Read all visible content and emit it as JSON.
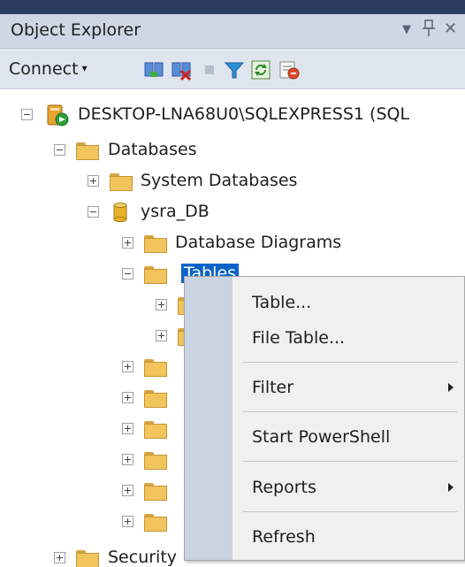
{
  "window": {
    "title": "Object Explorer",
    "pin_glyph": "↓",
    "pushpin_glyph": "ц",
    "close_glyph": "✕"
  },
  "toolbar": {
    "connect_label": "Connect",
    "connect_caret": "▾",
    "icons": [
      "connect-object-explorer-icon",
      "disconnect-icon",
      "stop-icon",
      "filter-icon",
      "refresh-icon",
      "activity-monitor-icon"
    ]
  },
  "tree": {
    "server": "DESKTOP-LNA68U0\\SQLEXPRESS1 (SQL",
    "databases": "Databases",
    "system_databases": "System Databases",
    "database": "ysra_DB",
    "database_diagrams": "Database Diagrams",
    "tables": "Tables",
    "security": "Security"
  },
  "context_menu": {
    "items": [
      {
        "label": "Table...",
        "has_submenu": false
      },
      {
        "label": "File Table...",
        "has_submenu": false
      },
      {
        "label": "Filter",
        "has_submenu": true
      },
      {
        "label": "Start PowerShell",
        "has_submenu": false
      },
      {
        "label": "Reports",
        "has_submenu": true
      },
      {
        "label": "Refresh",
        "has_submenu": false
      }
    ]
  },
  "colors": {
    "selection": "#0a64c8",
    "folder": "#f1c45c",
    "menu_gutter": "#c9d3e2"
  }
}
